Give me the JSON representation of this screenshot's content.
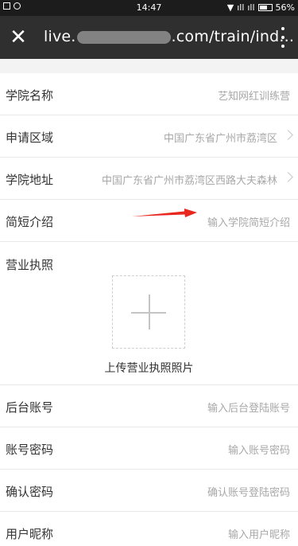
{
  "status": {
    "time": "14:47",
    "battery": "56%"
  },
  "browser": {
    "url_prefix": "live.",
    "url_suffix": ".com/train/ind..."
  },
  "form": {
    "college_name": {
      "label": "学院名称",
      "value": "艺知网红训练营"
    },
    "apply_region": {
      "label": "申请区域",
      "value": "中国广东省广州市荔湾区"
    },
    "college_address": {
      "label": "学院地址",
      "value": "中国广东省广州市荔湾区西路大夫森林"
    },
    "intro": {
      "label": "简短介绍",
      "placeholder": "输入学院简短介绍"
    },
    "license": {
      "label": "营业执照",
      "upload_label": "上传营业执照照片"
    },
    "account": {
      "label": "后台账号",
      "placeholder": "输入后台登陆账号"
    },
    "password": {
      "label": "账号密码",
      "placeholder": "输入账号密码"
    },
    "confirm_password": {
      "label": "确认密码",
      "placeholder": "确认账号登陆密码"
    },
    "nickname": {
      "label": "用户昵称",
      "placeholder": "输入用户昵称"
    }
  },
  "colors": {
    "annotation_arrow": "#e8281f",
    "toolbar": "#2f2f30"
  }
}
